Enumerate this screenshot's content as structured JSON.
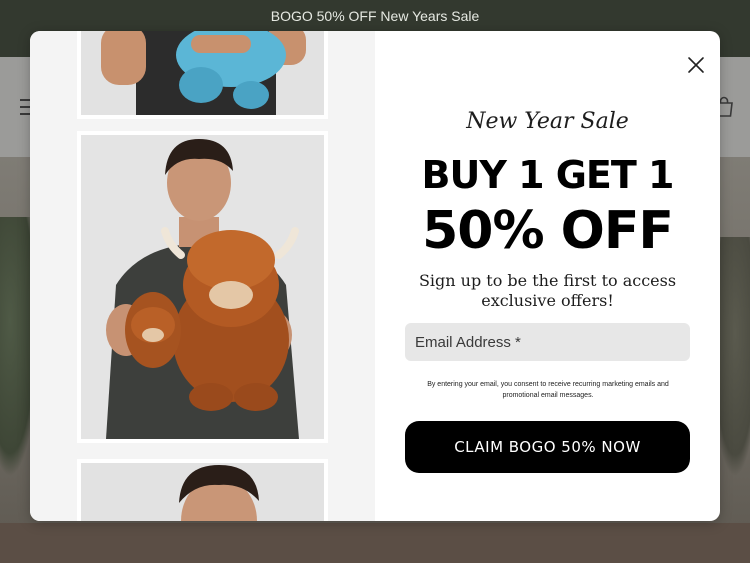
{
  "announcement": {
    "text": "BOGO 50% OFF New Years Sale"
  },
  "header": {
    "menu_icon": "hamburger-icon",
    "cart_icon": "shopping-bag-icon"
  },
  "popup": {
    "close_icon": "close-icon",
    "subtitle": "New Year Sale",
    "headline_line1": "BUY 1 GET 1",
    "headline_line2": "50% OFF",
    "lead": "Sign up to be the first to access exclusive offers!",
    "email": {
      "placeholder": "Email Address *",
      "value": ""
    },
    "consent": "By entering your email, you consent to receive recurring marketing emails and promotional email messages.",
    "cta_label": "CLAIM BOGO 50% NOW"
  },
  "colors": {
    "announcement_bg": "#33392f",
    "cta_bg": "#000000",
    "input_bg": "#e7e7e7"
  }
}
